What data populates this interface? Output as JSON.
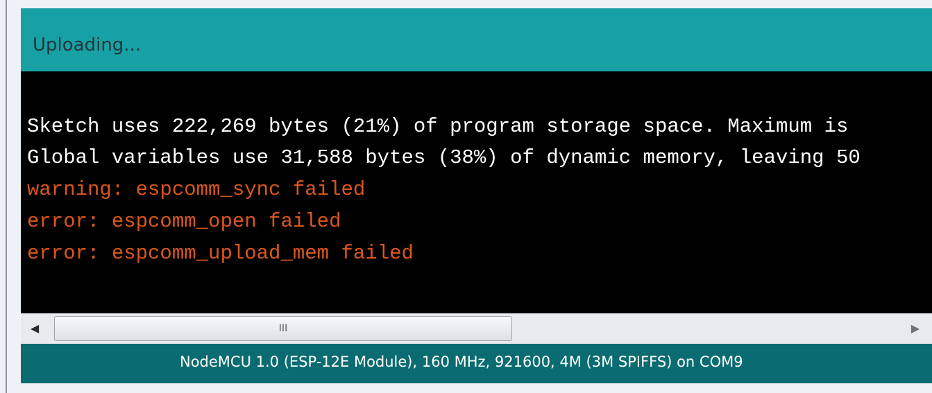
{
  "status": {
    "text": "Uploading..."
  },
  "console": {
    "lines": [
      {
        "text": "Sketch uses 222,269 bytes (21%) of program storage space. Maximum is",
        "kind": "info"
      },
      {
        "text": "Global variables use 31,588 bytes (38%) of dynamic memory, leaving 50",
        "kind": "info"
      },
      {
        "text": "warning: espcomm_sync failed",
        "kind": "error"
      },
      {
        "text": "error: espcomm_open failed",
        "kind": "error"
      },
      {
        "text": "error: espcomm_upload_mem failed",
        "kind": "error"
      }
    ]
  },
  "scrollbar": {
    "left_arrow": "◀",
    "right_arrow": "▶",
    "grip": "III"
  },
  "footer": {
    "board": "NodeMCU 1.0 (ESP-12E Module), 160 MHz, 921600, 4M (3M SPIFFS) on COM9"
  },
  "colors": {
    "status_bar": "#17a1a5",
    "console_bg": "#000000",
    "info_text": "#ffffff",
    "error_text": "#d9571c",
    "footer_bar": "#0a6c70"
  },
  "icons": {
    "left_arrow": "scroll-left-arrow-icon",
    "right_arrow": "scroll-right-arrow-icon",
    "grip": "scroll-grip-icon"
  }
}
